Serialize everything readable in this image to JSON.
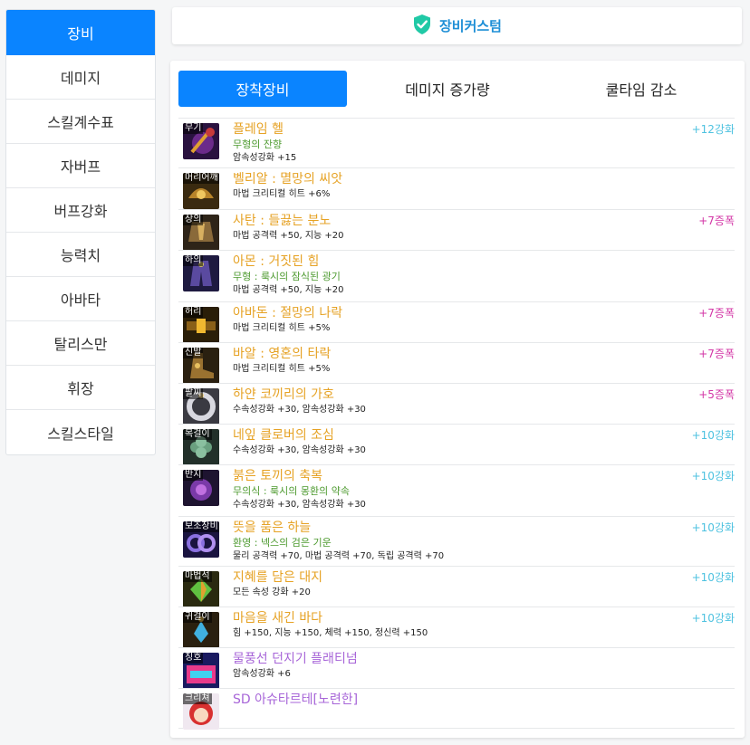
{
  "sidebar": {
    "items": [
      {
        "label": "장비"
      },
      {
        "label": "데미지"
      },
      {
        "label": "스킬계수표"
      },
      {
        "label": "자버프"
      },
      {
        "label": "버프강화"
      },
      {
        "label": "능력치"
      },
      {
        "label": "아바타"
      },
      {
        "label": "탈리스만"
      },
      {
        "label": "휘장"
      },
      {
        "label": "스킬스타일"
      }
    ]
  },
  "topbar": {
    "title": "장비커스텀",
    "icon": "shield-check-icon"
  },
  "tabs": [
    {
      "label": "장착장비"
    },
    {
      "label": "데미지 증가량"
    },
    {
      "label": "쿨타임 감소"
    }
  ],
  "colors": {
    "accent": "#0a84ff",
    "item_name": "#e6a224",
    "item_name_alt": "#a765d8",
    "option": "#4d9a2f",
    "upgrade": "#4ec2e0",
    "amplify": "#d336a6"
  },
  "items": [
    {
      "slot": "무기",
      "name": "플레임 헬",
      "sub": "무형의 잔향",
      "stats": "암속성강화 +15",
      "badge": "+12강화"
    },
    {
      "slot": "머리어깨",
      "name": "벨리알 : 멸망의 씨앗",
      "stats": "마법 크리티컬 히트 +6%"
    },
    {
      "slot": "상의",
      "name": "사탄 : 들끓는 분노",
      "stats": "마법 공격력 +50, 지능 +20",
      "badge": "+7증폭"
    },
    {
      "slot": "하의",
      "name": "아몬 : 거짓된 힘",
      "sub": "무형 : 룩시의 잠식된 광기",
      "stats": "마법 공격력 +50, 지능 +20"
    },
    {
      "slot": "허리",
      "name": "아바돈 : 절망의 나락",
      "stats": "마법 크리티컬 히트 +5%",
      "badge": "+7증폭"
    },
    {
      "slot": "신발",
      "name": "바알 : 영혼의 타락",
      "stats": "마법 크리티컬 히트 +5%",
      "badge": "+7증폭"
    },
    {
      "slot": "팔찌",
      "name": "하얀 코끼리의 가호",
      "stats": "수속성강화 +30, 암속성강화 +30",
      "badge": "+5증폭"
    },
    {
      "slot": "목걸이",
      "name": "네잎 클로버의 조심",
      "stats": "수속성강화 +30, 암속성강화 +30",
      "badge": "+10강화"
    },
    {
      "slot": "반지",
      "name": "붉은 토끼의 축복",
      "sub": "무의식 : 룩시의 몽환의 약속",
      "stats": "수속성강화 +30, 암속성강화 +30",
      "badge": "+10강화"
    },
    {
      "slot": "보조장비",
      "name": "뜻을 품은 하늘",
      "sub": "환영 : 넥스의 검은 기운",
      "stats": "물리 공격력 +70, 마법 공격력 +70, 독립 공격력 +70",
      "badge": "+10강화"
    },
    {
      "slot": "마법석",
      "name": "지혜를 담은 대지",
      "stats": "모든 속성 강화 +20",
      "badge": "+10강화"
    },
    {
      "slot": "귀걸이",
      "name": "마음을 새긴 바다",
      "stats": "힘 +150, 지능 +150, 체력 +150, 정신력 +150",
      "badge": "+10강화"
    },
    {
      "slot": "칭호",
      "name": "물풍선 던지기 플래티넘",
      "stats": "암속성강화 +6"
    },
    {
      "slot": "크리쳐",
      "name": "SD 아슈타르테[노련한]"
    }
  ]
}
